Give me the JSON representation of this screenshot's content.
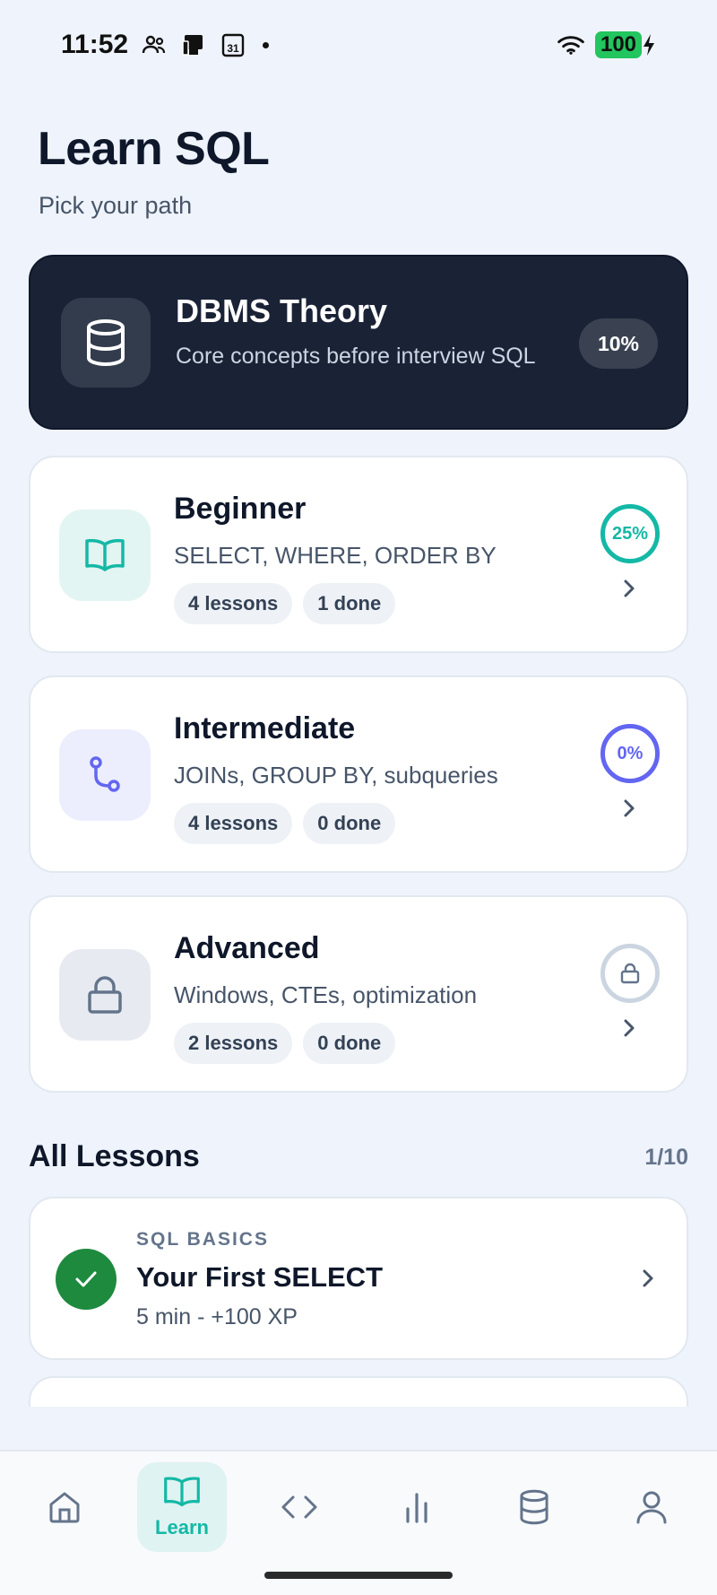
{
  "status": {
    "time": "11:52",
    "battery": "100"
  },
  "header": {
    "title": "Learn SQL",
    "subtitle": "Pick your path"
  },
  "theory": {
    "title": "DBMS Theory",
    "description": "Core concepts before interview SQL",
    "progress": "10%"
  },
  "levels": [
    {
      "title": "Beginner",
      "description": "SELECT, WHERE, ORDER BY",
      "lessons": "4 lessons",
      "done": "1 done",
      "progress": "25%",
      "color": "#14b8a6"
    },
    {
      "title": "Intermediate",
      "description": "JOINs, GROUP BY, subqueries",
      "lessons": "4 lessons",
      "done": "0 done",
      "progress": "0%",
      "color": "#6366f1"
    },
    {
      "title": "Advanced",
      "description": "Windows, CTEs, optimization",
      "lessons": "2 lessons",
      "done": "0 done",
      "locked": true,
      "color": "#cbd5e1"
    }
  ],
  "all_lessons": {
    "title": "All Lessons",
    "count": "1/10",
    "items": [
      {
        "category": "SQL BASICS",
        "title": "Your First SELECT",
        "meta": "5 min - +100 XP",
        "completed": true
      }
    ]
  },
  "nav": {
    "items": [
      {
        "icon": "home-icon"
      },
      {
        "icon": "book-icon",
        "label": "Learn",
        "active": true
      },
      {
        "icon": "code-icon"
      },
      {
        "icon": "chart-icon"
      },
      {
        "icon": "database-icon"
      },
      {
        "icon": "user-icon"
      }
    ]
  }
}
